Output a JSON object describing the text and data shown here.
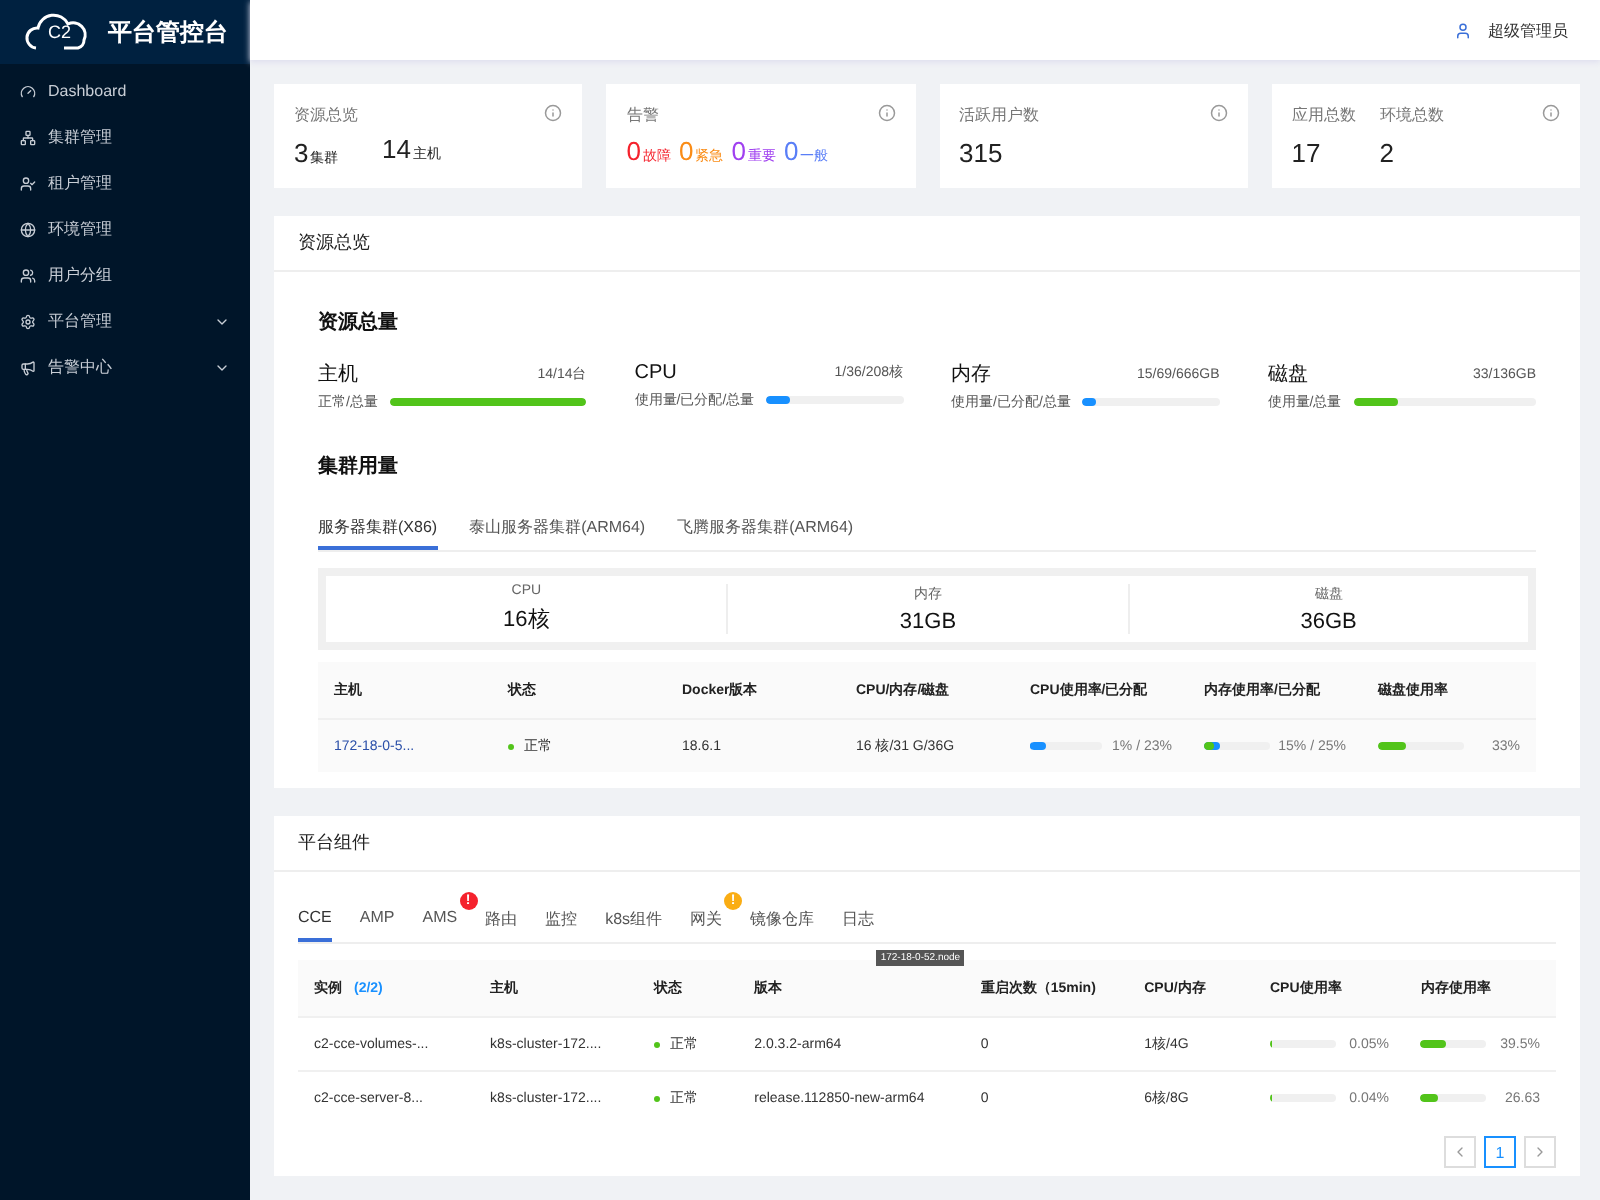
{
  "brand": {
    "mark": "C2",
    "title": "平台管控台"
  },
  "sidebar": {
    "items": [
      {
        "label": "Dashboard",
        "expandable": false
      },
      {
        "label": "集群管理",
        "expandable": false
      },
      {
        "label": "租户管理",
        "expandable": false
      },
      {
        "label": "环境管理",
        "expandable": false
      },
      {
        "label": "用户分组",
        "expandable": false
      },
      {
        "label": "平台管理",
        "expandable": true
      },
      {
        "label": "告警中心",
        "expandable": true
      }
    ]
  },
  "header": {
    "user": "超级管理员"
  },
  "stat_cards": [
    {
      "kind": "pairs",
      "items": [
        {
          "label": "资源总览",
          "value": "3",
          "unit": "集群"
        },
        {
          "value": "14",
          "unit": "主机"
        }
      ]
    },
    {
      "kind": "alerts",
      "label": "告警",
      "items": [
        {
          "value": "0",
          "unit": "故障",
          "color": "#f5222d"
        },
        {
          "value": "0",
          "unit": "紧急",
          "color": "#fa8c16"
        },
        {
          "value": "0",
          "unit": "重要",
          "color": "#a040f0"
        },
        {
          "value": "0",
          "unit": "一般",
          "color": "#597ef7"
        }
      ]
    },
    {
      "kind": "pairs",
      "items": [
        {
          "label": "活跃用户数",
          "value": "315"
        }
      ]
    },
    {
      "kind": "pairs",
      "items": [
        {
          "label": "应用总数",
          "value": "17"
        },
        {
          "label": "环境总数",
          "value": "2"
        }
      ]
    }
  ],
  "resource_panel": {
    "title": "资源总览",
    "totals_title": "资源总量",
    "totals": [
      {
        "name": "主机",
        "sub": "正常/总量",
        "reading": "14/14台",
        "level": 1,
        "color": "#52c41a"
      },
      {
        "name": "CPU",
        "sub": "使用量/已分配/总量",
        "reading": "1/36/208核",
        "level": 0.17,
        "color": "#1890ff"
      },
      {
        "name": "内存",
        "sub": "使用量/已分配/总量",
        "reading": "15/69/666GB",
        "level": 0.1,
        "color": "#1890ff"
      },
      {
        "name": "磁盘",
        "sub": "使用量/总量",
        "reading": "33/136GB",
        "level": 0.24,
        "color": "#52c41a"
      }
    ],
    "cluster_title": "集群用量",
    "cluster_tabs": [
      {
        "label": "服务器集群(X86)",
        "selected": true
      },
      {
        "label": "泰山服务器集群(ARM64)",
        "selected": false
      },
      {
        "label": "飞腾服务器集群(ARM64)",
        "selected": false
      }
    ],
    "summary": [
      {
        "label": "CPU",
        "value": "16核"
      },
      {
        "label": "内存",
        "value": "31GB"
      },
      {
        "label": "磁盘",
        "value": "36GB"
      }
    ],
    "host_table": {
      "columns": [
        "主机",
        "状态",
        "Docker版本",
        "CPU/内存/磁盘",
        "CPU使用率/已分配",
        "内存使用率/已分配",
        "磁盘使用率"
      ],
      "rows": [
        {
          "host": "172-18-0-5...",
          "status": "正常",
          "docker": "18.6.1",
          "spec": "16 核/31 G/36G",
          "cpu": {
            "level": 0.01,
            "allocated": {
              "level": 0.23
            },
            "reading": "1% / 23%"
          },
          "memory": {
            "level": 0.15,
            "allocated": {
              "level": 0.25
            },
            "reading": "15% / 25%"
          },
          "disk": {
            "level": 0.33,
            "reading": "33%"
          }
        }
      ]
    }
  },
  "components_panel": {
    "title": "平台组件",
    "tabs": [
      {
        "label": "CCE",
        "selected": true
      },
      {
        "label": "AMP",
        "selected": false
      },
      {
        "label": "AMS",
        "selected": false,
        "badge": "!",
        "color": "#f5222d"
      },
      {
        "label": "路由",
        "selected": false
      },
      {
        "label": "监控",
        "selected": false
      },
      {
        "label": "k8s组件",
        "selected": false
      },
      {
        "label": "网关",
        "selected": false,
        "badge": "!",
        "color": "#faad14"
      },
      {
        "label": "镜像仓库",
        "selected": false
      },
      {
        "label": "日志",
        "selected": false
      }
    ],
    "table": {
      "columns": [
        "实例",
        "主机",
        "状态",
        "版本",
        "重启次数（15min)",
        "CPU/内存",
        "CPU使用率",
        "内存使用率"
      ],
      "instance_count": "(2/2)",
      "tooltip": "172-18-0-52.node",
      "rows": [
        {
          "instance": "c2-cce-volumes-...",
          "host": "k8s-cluster-172....",
          "status": "正常",
          "version": "2.0.3.2-arm64",
          "restarts": "0",
          "spec": "1核/4G",
          "cpu": {
            "level": 0.005,
            "reading": "0.05%"
          },
          "memory": {
            "level": 0.395,
            "reading": "39.5%"
          }
        },
        {
          "instance": "c2-cce-server-8...",
          "host": "k8s-cluster-172....",
          "status": "正常",
          "version": "release.112850-new-arm64",
          "restarts": "0",
          "spec": "6核/8G",
          "cpu": {
            "level": 0.004,
            "reading": "0.04%"
          },
          "memory": {
            "level": 0.266,
            "reading": "26.63"
          }
        }
      ]
    },
    "pagination": {
      "page": "1"
    }
  }
}
